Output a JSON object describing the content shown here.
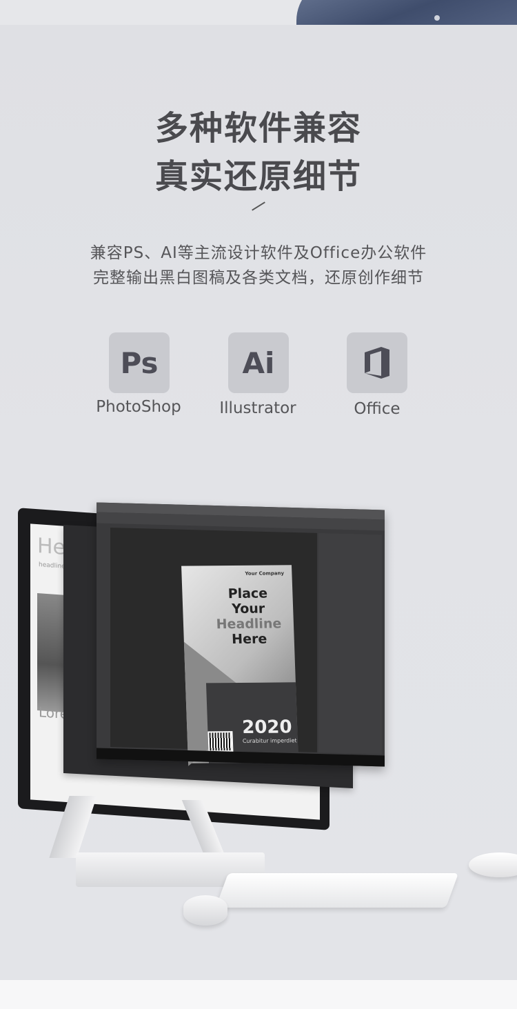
{
  "headline": {
    "line1": "多种软件兼容",
    "line2": "真实还原细节"
  },
  "description": {
    "line1": "兼容PS、AI等主流设计软件及Office办公软件",
    "line2": "完整输出黑白图稿及各类文档，还原创作细节"
  },
  "software": [
    {
      "icon_text": "Ps",
      "label": "PhotoShop",
      "icon": "photoshop-icon"
    },
    {
      "icon_text": "Ai",
      "label": "Illustrator",
      "icon": "illustrator-icon"
    },
    {
      "icon_text": "",
      "label": "Office",
      "icon": "office-icon"
    }
  ],
  "poster": {
    "company": "Your Company",
    "title_line1": "Place Your",
    "title_line2": "Headline",
    "title_line3": "Here",
    "year": "2020",
    "caption": "Curabitur imperdiet",
    "barcode": "1987870215"
  },
  "background_monitor": {
    "heading": "Hea",
    "sub": "headline.in",
    "lore": "Lore"
  },
  "colors": {
    "panel": "#e0e1e5",
    "icon_bg": "#c9cacf",
    "heading": "#4a4a4e"
  }
}
